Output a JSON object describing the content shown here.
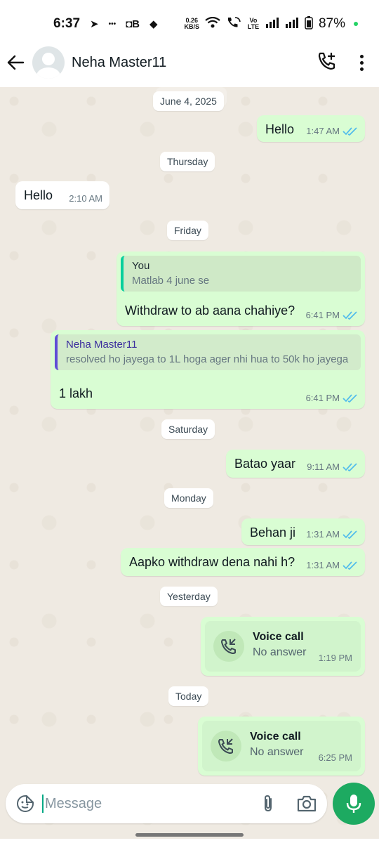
{
  "status_bar": {
    "time": "6:37",
    "net_speed_value": "0.26",
    "net_speed_unit": "KB/S",
    "volte": "Vo LTE",
    "battery": "87%"
  },
  "header": {
    "contact_name": "Neha Master11"
  },
  "chat": {
    "date_top_faded": "June 4, 2025",
    "date_top": "June 4, 2025",
    "msg1": {
      "text": "Hello",
      "time": "1:47 AM"
    },
    "date_thursday": "Thursday",
    "msg2": {
      "text": "Hello",
      "time": "2:10 AM"
    },
    "date_friday": "Friday",
    "msg3": {
      "quote_author": "You",
      "quote_text": "Matlab 4 june se",
      "text": "Withdraw to ab aana chahiye?",
      "time": "6:41 PM"
    },
    "msg4": {
      "quote_author": "Neha Master11",
      "quote_text": "resolved ho jayega to 1L hoga ager nhi hua to 50k ho jayega",
      "text": "1 lakh",
      "time": "6:41 PM"
    },
    "date_saturday": "Saturday",
    "msg5": {
      "text": "Batao yaar",
      "time": "9:11 AM"
    },
    "date_monday": "Monday",
    "msg6": {
      "text": "Behan ji",
      "time": "1:31 AM"
    },
    "msg7": {
      "text": "Aapko withdraw dena nahi h?",
      "time": "1:31 AM"
    },
    "date_yesterday": "Yesterday",
    "call1": {
      "title": "Voice call",
      "status": "No answer",
      "time": "1:19 PM"
    },
    "date_today": "Today",
    "call2": {
      "title": "Voice call",
      "status": "No answer",
      "time": "6:25 PM"
    }
  },
  "input": {
    "placeholder": "Message"
  },
  "colors": {
    "outgoing_bubble": "#d9fdd3",
    "incoming_bubble": "#ffffff",
    "read_ticks": "#53bdeb",
    "accent_green": "#1daa61",
    "chat_background": "#efeae2"
  },
  "icons": [
    "back-arrow-icon",
    "add-call-icon",
    "more-vert-icon",
    "sticker-icon",
    "attach-icon",
    "camera-icon",
    "mic-icon",
    "missed-call-icon",
    "double-check-icon"
  ]
}
